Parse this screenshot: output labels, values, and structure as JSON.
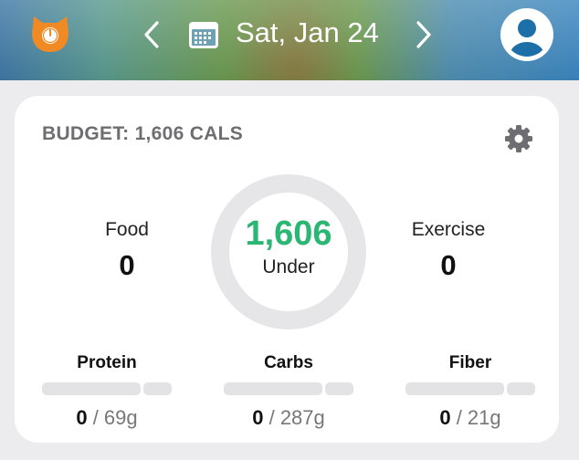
{
  "header": {
    "date": "Sat, Jan 24",
    "icons": {
      "logo": "cat-logo-icon",
      "prev": "chevron-left-icon",
      "calendar": "calendar-icon",
      "next": "chevron-right-icon",
      "profile": "user-avatar-icon"
    }
  },
  "budget": {
    "title": "BUDGET: 1,606 CALS",
    "settings_icon": "gear-icon"
  },
  "summary": {
    "food_label": "Food",
    "food_value": "0",
    "remaining_value": "1,606",
    "remaining_label": "Under",
    "exercise_label": "Exercise",
    "exercise_value": "0",
    "ring_progress": 0
  },
  "macros": [
    {
      "name": "Protein",
      "current": "0",
      "target": " / 69g",
      "progress": 0
    },
    {
      "name": "Carbs",
      "current": "0",
      "target": " / 287g",
      "progress": 0
    },
    {
      "name": "Fiber",
      "current": "0",
      "target": " / 21g",
      "progress": 0
    }
  ],
  "colors": {
    "accent_green": "#2bb673",
    "avatar_blue": "#1d6fa8",
    "logo_orange": "#f08a24",
    "ring_gray": "#e6e6e9"
  }
}
